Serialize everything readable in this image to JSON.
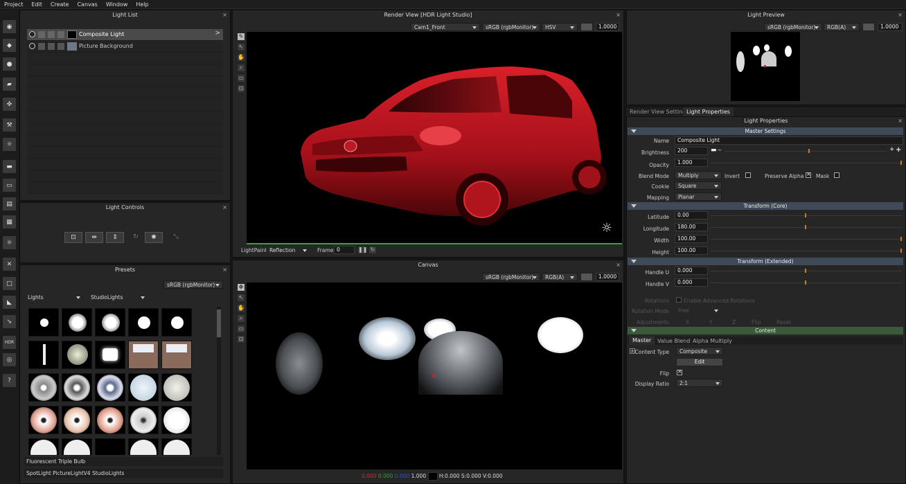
{
  "menu": [
    "Project",
    "Edit",
    "Create",
    "Canvas",
    "Window",
    "Help"
  ],
  "light_list": {
    "title": "Light List",
    "items": [
      {
        "label": "Composite Light"
      },
      {
        "label": "Picture Background"
      }
    ]
  },
  "light_controls": {
    "title": "Light Controls"
  },
  "presets": {
    "title": "Presets",
    "colorspace": "sRGB (rgbMonitor)",
    "category": "Lights",
    "library": "StudioLights",
    "selected_name": "Fluorescent Triple Bulb",
    "status": "SpotLight PictureLightV4 StudioLights"
  },
  "render_view": {
    "title": "Render View [HDR Light Studio]",
    "camera": "Cam1_Front",
    "colorspace": "sRGB (rgbMonitor)",
    "mode": "HSV",
    "exposure": "1.0000",
    "lightpaint_label": "LightPaint",
    "lightpaint_mode": "Reflection",
    "frame_label": "Frame",
    "frame_value": "0"
  },
  "canvas": {
    "title": "Canvas",
    "colorspace": "sRGB (rgbMonitor)",
    "channel": "RGB(A)",
    "exposure": "1.0000",
    "status": {
      "r": "0.000",
      "g": "0.000",
      "b": "0.000",
      "a": "1.000",
      "hsv": "H:0.000 S:0.000 V:0.000"
    }
  },
  "light_preview": {
    "title": "Light Preview",
    "colorspace": "sRGB (rgbMonitor)",
    "channel": "RGB(A)",
    "exposure": "1.0000"
  },
  "tabs": [
    "Render View Settings",
    "Light Properties"
  ],
  "light_properties": {
    "title": "Light Properties",
    "master_settings": "Master Settings",
    "name_label": "Name",
    "name_value": "Composite Light",
    "brightness_label": "Brightness",
    "brightness_value": "200",
    "opacity_label": "Opacity",
    "opacity_value": "1.000",
    "blend_label": "Blend Mode",
    "blend_value": "Multiply",
    "invert_label": "Invert",
    "preserve_alpha_label": "Preserve Alpha",
    "mask_label": "Mask",
    "cookie_label": "Cookie",
    "cookie_value": "Square",
    "mapping_label": "Mapping",
    "mapping_value": "Planar",
    "transform_core": "Transform (Core)",
    "latitude_label": "Latitude",
    "latitude_value": "0.00",
    "longitude_label": "Longitude",
    "longitude_value": "180.00",
    "width_label": "Width",
    "width_value": "100.00",
    "height_label": "Height",
    "height_value": "100.00",
    "transform_extended": "Transform (Extended)",
    "handle_u_label": "Handle U",
    "handle_u_value": "0.000",
    "handle_v_label": "Handle V",
    "handle_v_value": "0.000",
    "rotations_label": "Rotations",
    "rotations_check": "Enable Advanced Rotations",
    "rotation_mode_label": "Rotation Mode",
    "rotation_mode_value": "Free",
    "adjustments_label": "Adjustments",
    "adj_x": "X",
    "adj_y": "Y",
    "adj_z": "Z",
    "flip_disabled": "Flip",
    "reset": "Reset",
    "content": "Content",
    "content_tabs": [
      "Master",
      "Value Blend",
      "Alpha Multiply"
    ],
    "content_type_label": "Content Type",
    "content_type_value": "Composite",
    "edit_button": "Edit",
    "flip_label": "Flip",
    "display_ratio_label": "Display Ratio",
    "display_ratio_value": "2:1"
  }
}
